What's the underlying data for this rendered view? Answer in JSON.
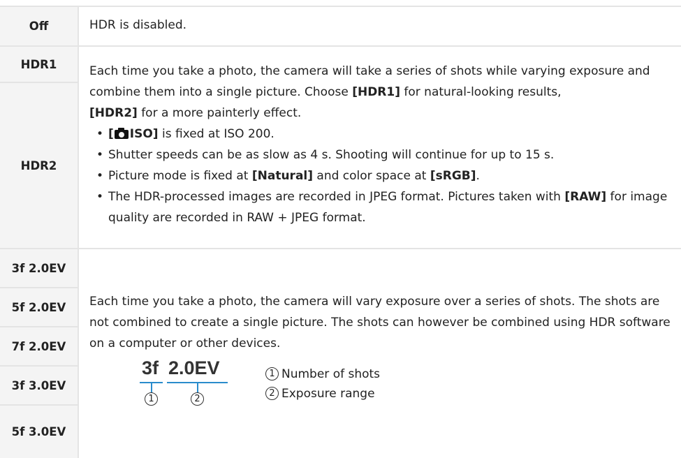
{
  "rows": {
    "off": {
      "label": "Off",
      "desc": "HDR is disabled."
    },
    "hdr1": {
      "label": "HDR1"
    },
    "hdr2": {
      "label": "HDR2"
    },
    "hdr_desc": {
      "p1": "Each time you take a photo, the camera will take a series of shots while varying exposure and combine them into a single picture. Choose ",
      "hdr1_ref": "[HDR1]",
      "p2": " for natural-looking results, ",
      "hdr2_ref": "[HDR2]",
      "p3": " for a more painterly effect.",
      "bullets": {
        "b1_open": "[",
        "b1_iso": "ISO]",
        "b1_text": " is fixed at ISO 200.",
        "b2": "Shutter speeds can be as slow as 4 s. Shooting will continue for up to 15 s.",
        "b3_a": "Picture mode is fixed at ",
        "b3_natural": "[Natural]",
        "b3_b": " and color space at ",
        "b3_srgb": "[sRGB]",
        "b3_c": ".",
        "b4_a": "The HDR-processed images are recorded in JPEG format. Pictures taken with ",
        "b4_raw": "[RAW]",
        "b4_b": " for image quality are recorded in RAW + JPEG format."
      }
    },
    "bracket_labels": [
      "3f 2.0EV",
      "5f 2.0EV",
      "7f 2.0EV",
      "3f 3.0EV",
      "5f 3.0EV"
    ],
    "bracket_desc": "Each time you take a photo, the camera will vary exposure over a series of shots. The shots are not combined to create a single picture. The shots can however be combined using HDR software on a computer or other devices."
  },
  "diagram": {
    "shots": "3f",
    "range": "2.0EV",
    "marker1": "1",
    "marker2": "2",
    "legend1": "Number of shots",
    "legend2": "Exposure range",
    "line_color": "#2a8ccc"
  },
  "icons": {
    "camera": "camera-icon"
  }
}
